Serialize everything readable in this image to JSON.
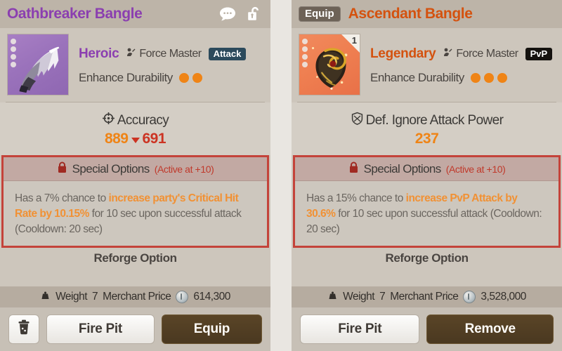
{
  "panels": [
    {
      "key": "left",
      "titlebar": {
        "title": "Oathbreaker Bangle",
        "equip_badge": null,
        "icons": [
          "chat-bubble-icon",
          "unlock-icon"
        ]
      },
      "item": {
        "thumb_style": "heroic",
        "count": null,
        "rarity": "Heroic",
        "class_name": "Force Master",
        "tag": "Attack",
        "tag_style": "attack",
        "durability_label": "Enhance Durability",
        "durability_pips": 2
      },
      "main_stat": {
        "name": "Accuracy",
        "icon": "crosshair-icon",
        "base_value": "889",
        "current_value": "691",
        "has_arrow": true
      },
      "special": {
        "label": "Special Options",
        "active_note": "(Active at +10)",
        "lock_icon": "lock-icon",
        "text_parts": [
          {
            "t": "Has a 7% chance to ",
            "hl": false
          },
          {
            "t": "increase party's Critical Hit Rate by 10.15%",
            "hl": true
          },
          {
            "t": " for 10 sec upon successful attack (Cooldown: 20 sec)",
            "hl": false
          }
        ]
      },
      "reforge_label": "Reforge Option",
      "weight": {
        "weight_label": "Weight",
        "weight_value": "7",
        "price_label": "Merchant Price",
        "price_value": "614,300",
        "coin_icon": "silver-coin-icon"
      },
      "actions": {
        "trash": "trash-icon",
        "secondary": "Fire Pit",
        "primary": "Equip"
      }
    },
    {
      "key": "right",
      "titlebar": {
        "title": "Ascendant Bangle",
        "equip_badge": "Equip",
        "icons": []
      },
      "item": {
        "thumb_style": "legend",
        "count": "1",
        "rarity": "Legendary",
        "class_name": "Force Master",
        "tag": "PvP",
        "tag_style": "pvp",
        "durability_label": "Enhance Durability",
        "durability_pips": 3
      },
      "main_stat": {
        "name": "Def. Ignore Attack Power",
        "icon": "shield-icon",
        "base_value": "237",
        "current_value": null,
        "has_arrow": false
      },
      "special": {
        "label": "Special Options",
        "active_note": "(Active at +10)",
        "lock_icon": "lock-icon",
        "text_parts": [
          {
            "t": "Has a 15% chance to ",
            "hl": false
          },
          {
            "t": "increase PvP Attack by 30.6%",
            "hl": true
          },
          {
            "t": " for 10 sec upon successful attack (Cooldown: 20 sec)",
            "hl": false
          }
        ]
      },
      "reforge_label": "Reforge Option",
      "weight": {
        "weight_label": "Weight",
        "weight_value": "7",
        "price_label": "Merchant Price",
        "price_value": "3,528,000",
        "coin_icon": "silver-coin-icon"
      },
      "actions": {
        "trash": null,
        "secondary": "Fire Pit",
        "primary": "Remove"
      }
    }
  ],
  "colors": {
    "heroic_purple": "#8b3fb0",
    "legendary_orange": "#d4520f",
    "highlight_orange": "#f19134",
    "stat_orange": "#ef8416",
    "stat_red": "#cc3322",
    "special_border": "#c4433a",
    "panel_bg": "#cdc6bc",
    "titlebar_bg": "#bdb4a8"
  }
}
